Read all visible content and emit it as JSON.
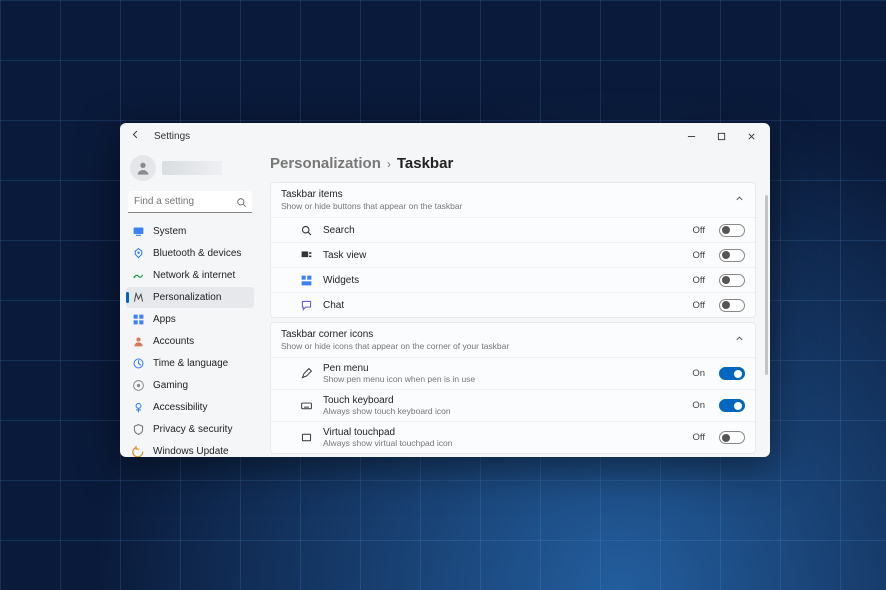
{
  "window": {
    "app_title": "Settings"
  },
  "profile": {
    "name_placeholder": ""
  },
  "search": {
    "placeholder": "Find a setting"
  },
  "sidebar": {
    "items": [
      {
        "label": "System"
      },
      {
        "label": "Bluetooth & devices"
      },
      {
        "label": "Network & internet"
      },
      {
        "label": "Personalization"
      },
      {
        "label": "Apps"
      },
      {
        "label": "Accounts"
      },
      {
        "label": "Time & language"
      },
      {
        "label": "Gaming"
      },
      {
        "label": "Accessibility"
      },
      {
        "label": "Privacy & security"
      },
      {
        "label": "Windows Update"
      }
    ],
    "active_index": 3
  },
  "breadcrumb": {
    "parent": "Personalization",
    "current": "Taskbar"
  },
  "groups": [
    {
      "title": "Taskbar items",
      "subtitle": "Show or hide buttons that appear on the taskbar",
      "expanded": true,
      "rows": [
        {
          "icon": "search",
          "title": "Search",
          "sub": "",
          "state": "Off",
          "on": false
        },
        {
          "icon": "taskview",
          "title": "Task view",
          "sub": "",
          "state": "Off",
          "on": false
        },
        {
          "icon": "widgets",
          "title": "Widgets",
          "sub": "",
          "state": "Off",
          "on": false
        },
        {
          "icon": "chat",
          "title": "Chat",
          "sub": "",
          "state": "Off",
          "on": false
        }
      ]
    },
    {
      "title": "Taskbar corner icons",
      "subtitle": "Show or hide icons that appear on the corner of your taskbar",
      "expanded": true,
      "rows": [
        {
          "icon": "pen",
          "title": "Pen menu",
          "sub": "Show pen menu icon when pen is in use",
          "state": "On",
          "on": true
        },
        {
          "icon": "keyboard",
          "title": "Touch keyboard",
          "sub": "Always show touch keyboard icon",
          "state": "On",
          "on": true
        },
        {
          "icon": "touchpad",
          "title": "Virtual touchpad",
          "sub": "Always show virtual touchpad icon",
          "state": "Off",
          "on": false
        }
      ]
    }
  ],
  "toggle_labels": {
    "on": "On",
    "off": "Off"
  }
}
